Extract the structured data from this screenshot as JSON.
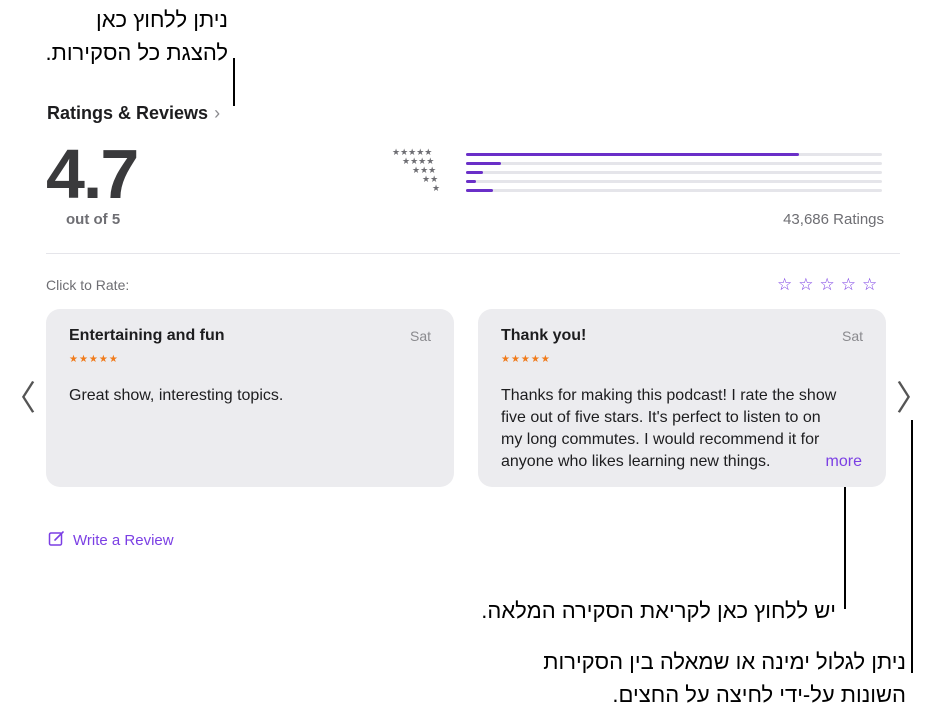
{
  "callouts": {
    "top_line1": "ניתן ללחוץ כאן",
    "top_line2": "להצגת כל הסקירות.",
    "more_note": "יש ללחוץ כאן לקריאת הסקירה המלאה.",
    "scroll_line1": "ניתן לגלול ימינה או שמאלה בין הסקירות",
    "scroll_line2": "השונות על-ידי לחיצה על החצים."
  },
  "header": {
    "title": "Ratings & Reviews",
    "chevron": "›"
  },
  "summary": {
    "score": "4.7",
    "out_of": "out of 5",
    "total": "43,686 Ratings"
  },
  "histogram": [
    {
      "stars": "★★★★★",
      "fraction": 0.8
    },
    {
      "stars": "★★★★",
      "fraction": 0.085
    },
    {
      "stars": "★★★",
      "fraction": 0.04
    },
    {
      "stars": "★★",
      "fraction": 0.025
    },
    {
      "stars": "★",
      "fraction": 0.065
    }
  ],
  "rate": {
    "label": "Click to Rate:",
    "stars": [
      "☆",
      "☆",
      "☆",
      "☆",
      "☆"
    ]
  },
  "reviews": [
    {
      "title": "Entertaining and fun",
      "date": "Sat",
      "stars": "★★★★★",
      "body": "Great show, interesting topics."
    },
    {
      "title": "Thank you!",
      "date": "Sat",
      "stars": "★★★★★",
      "body": "Thanks for making this podcast! I rate the show five out of five stars. It's perfect to listen to on my long commutes. I would recommend it for anyone who likes learning new things.",
      "more": "more"
    }
  ],
  "nav": {
    "prev": "〈",
    "next": "〉"
  },
  "write_review": {
    "label": "Write a Review",
    "icon": "compose-icon"
  },
  "colors": {
    "accent": "#7b3fe4",
    "bar": "#6a2fc8",
    "card": "#ececef",
    "review_stars": "#f07b1c"
  }
}
